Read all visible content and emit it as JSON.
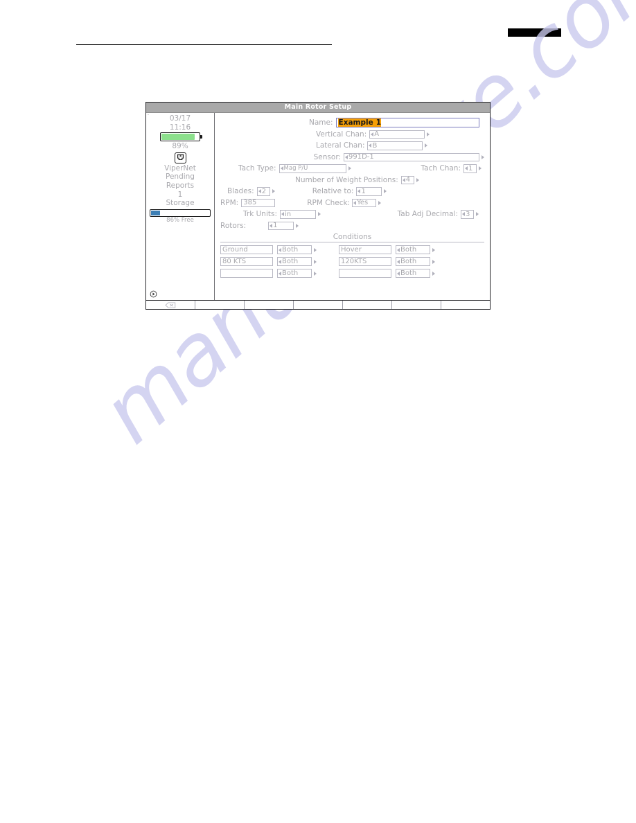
{
  "page": {
    "watermark": "manualshive.com",
    "redacted_header_label": ""
  },
  "window": {
    "title": "Main Rotor Setup"
  },
  "sidebar": {
    "date": "03/17",
    "time": "11:16",
    "battery_percent": "89%",
    "battery_level": 89,
    "network_icon": "ethernet-port-icon",
    "network_name": "ViperNet",
    "pending_label": "Pending",
    "reports_label": "Reports",
    "reports_count": "1",
    "storage_label": "Storage",
    "storage_free": "86% Free",
    "storage_used_percent": 16,
    "play_icon": "play-circle-icon"
  },
  "form": {
    "name": {
      "label": "Name:",
      "value_selected": "Example",
      "value_rest": "1"
    },
    "vertical_chan": {
      "label": "Vertical Chan:",
      "value": "A"
    },
    "lateral_chan": {
      "label": "Lateral Chan:",
      "value": "B"
    },
    "sensor": {
      "label": "Sensor:",
      "value": "991D-1"
    },
    "tach_type": {
      "label": "Tach Type:",
      "value": "Mag P/U"
    },
    "tach_chan": {
      "label": "Tach Chan:",
      "value": "1"
    },
    "weight_positions": {
      "label": "Number of Weight Positions:",
      "value": "4"
    },
    "blades": {
      "label": "Blades:",
      "value": "2"
    },
    "relative_to": {
      "label": "Relative to:",
      "value": "1"
    },
    "rpm": {
      "label": "RPM:",
      "value": "385"
    },
    "rpm_check": {
      "label": "RPM Check:",
      "value": "Yes"
    },
    "trk_units": {
      "label": "Trk Units:",
      "value": "in"
    },
    "tab_adj_decimal": {
      "label": "Tab Adj Decimal:",
      "value": "3"
    },
    "rotors": {
      "label": "Rotors:",
      "value": "1"
    }
  },
  "conditions": {
    "title": "Conditions",
    "rows": [
      {
        "left_name": "Ground",
        "left_mode": "Both",
        "right_name": "Hover",
        "right_mode": "Both"
      },
      {
        "left_name": "80 KTS",
        "left_mode": "Both",
        "right_name": "120KTS",
        "right_mode": "Both"
      },
      {
        "left_name": "",
        "left_mode": "Both",
        "right_name": "",
        "right_mode": "Both"
      }
    ]
  },
  "toolbar": {
    "cells": [
      {
        "icon": "backspace-icon",
        "label": ""
      },
      {
        "icon": "",
        "label": ""
      },
      {
        "icon": "",
        "label": ""
      },
      {
        "icon": "",
        "label": ""
      },
      {
        "icon": "",
        "label": ""
      },
      {
        "icon": "",
        "label": ""
      },
      {
        "icon": "",
        "label": ""
      }
    ]
  },
  "colors": {
    "titlebar": "#a9a9a9",
    "selection_highlight": "#f59f06",
    "battery_fill": "#8ce08c",
    "storage_fill": "#3d7fb5",
    "focus_border": "#7b7bbd",
    "watermark": "#c9c9ee"
  }
}
